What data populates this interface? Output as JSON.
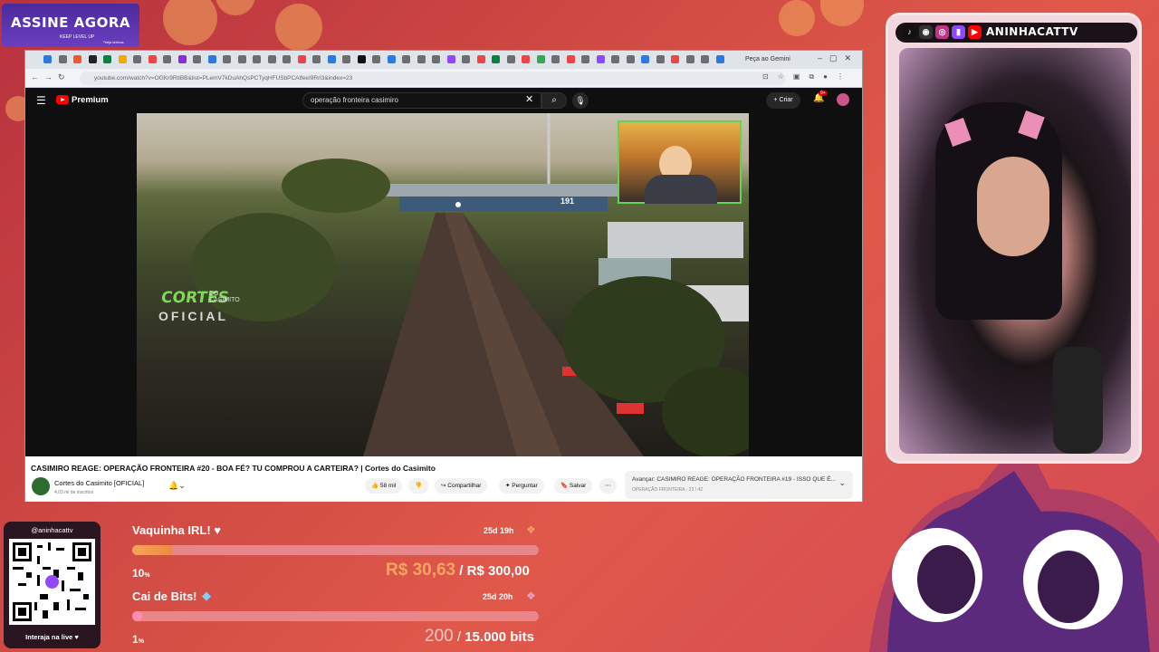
{
  "promo": {
    "title": "ASSINE AGORA",
    "brand": "KEEP LEVEL UP",
    "tagline": "*Veja termos"
  },
  "browser": {
    "url": "youtube.com/watch?v=OGKr9RtiBB&list=PLemV7kDuAhQsPCTyqHFUSbPCAlfeeI9Rrl3&index=23",
    "gemini_label": "Peça ao Gemini",
    "tab_colors": [
      "#2a7ae2",
      "#6d6d6d",
      "#f05a28",
      "#222",
      "#0b8043",
      "#f2a900",
      "#6d6d6d",
      "#e44",
      "#6d6d6d",
      "#8a2be2",
      "#6d6d6d",
      "#2a7ae2",
      "#6d6d6d",
      "#6d6d6d",
      "#6d6d6d",
      "#6d6d6d",
      "#6d6d6d",
      "#e44",
      "#6d6d6d",
      "#2a7ae2",
      "#6d6d6d",
      "#111",
      "#6d6d6d",
      "#2a7ae2",
      "#6d6d6d",
      "#6d6d6d",
      "#6d6d6d",
      "#9146ff",
      "#6d6d6d",
      "#e44",
      "#0b8043",
      "#6d6d6d",
      "#e44",
      "#34a853",
      "#6d6d6d",
      "#e44",
      "#6d6d6d",
      "#9146ff",
      "#6d6d6d",
      "#6d6d6d",
      "#2a7ae2",
      "#6d6d6d",
      "#e44",
      "#6d6d6d",
      "#6d6d6d",
      "#2a7ae2"
    ]
  },
  "youtube": {
    "logo": "Premium",
    "search_value": "operação fronteira casimiro",
    "create_label": "Criar",
    "notif_badge": "9+",
    "video_title": "CASIMIRO REAGE: OPERAÇÃO FRONTEIRA #20 - BOA FÉ? TU COMPROU A CARTEIRA? | Cortes do Casimito",
    "channel": "Cortes do Casimito [OFICIAL]",
    "subs": "4,03 mi de inscritos",
    "likes": "58 mil",
    "share": "Compartilhar",
    "ask": "Perguntar",
    "save": "Salvar",
    "next_label": "Avançar: CASIMIRO REAGE: OPERAÇÃO FRONTEIRA #19 - ISSO QUE É...",
    "next_sub": "OPERAÇÃO FRONTEIRA - 23 / 42",
    "video_overlay": {
      "brand": "CORTES",
      "do_label": "DO",
      "casimito": "CASIMITO",
      "oficial": "OFICIAL",
      "road_sign": "191"
    }
  },
  "stream": {
    "handle": "ANINHACATTV"
  },
  "qr": {
    "handle": "@aninhacattv",
    "cta": "Interaja na live ♥"
  },
  "goals": [
    {
      "title": "Vaquinha IRL! ♥",
      "time": "25d 19h",
      "percent": "10",
      "value": "R$ 30,63",
      "sep": " / ",
      "target": "R$ 300,00",
      "progress": 0.1
    },
    {
      "title": "Cai de Bits!",
      "time": "25d 20h",
      "percent": "1",
      "value": "200",
      "sep": " / ",
      "target": "15.000 bits",
      "progress": 0.01
    }
  ],
  "colors": {
    "accent_orange": "#f08a3e",
    "cam_border": "#5fd35a",
    "youtube_red": "#ff0000"
  }
}
